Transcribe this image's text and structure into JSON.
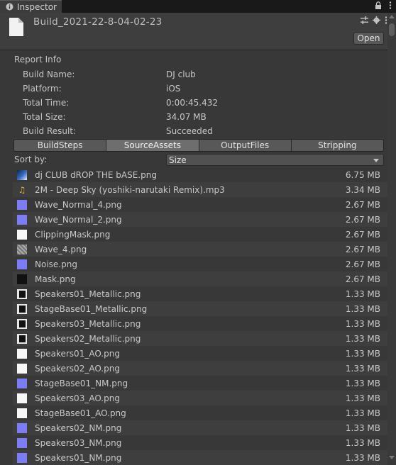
{
  "window": {
    "tab_label": "Inspector"
  },
  "header": {
    "title": "Build_2021-22-8-04-02-23",
    "open_button": "Open"
  },
  "report": {
    "section_title": "Report Info",
    "rows": [
      {
        "label": "Build Name:",
        "value": "DJ club"
      },
      {
        "label": "Platform:",
        "value": "iOS"
      },
      {
        "label": "Total Time:",
        "value": "0:00:45.432"
      },
      {
        "label": "Total Size:",
        "value": "34.07 MB"
      },
      {
        "label": "Build Result:",
        "value": "Succeeded"
      }
    ]
  },
  "tabs": [
    {
      "label": "BuildSteps",
      "active": false
    },
    {
      "label": "SourceAssets",
      "active": true
    },
    {
      "label": "OutputFiles",
      "active": false
    },
    {
      "label": "Stripping",
      "active": false
    }
  ],
  "sort": {
    "label": "Sort by:",
    "value": "Size"
  },
  "assets": [
    {
      "name": "dj CLUB dROP THE bASE.png",
      "size": "6.75 MB",
      "icon": "image-icon"
    },
    {
      "name": "2M - Deep Sky (yoshiki-narutaki Remix).mp3",
      "size": "3.34 MB",
      "icon": "audio-icon"
    },
    {
      "name": "Wave_Normal_4.png",
      "size": "2.67 MB",
      "icon": "normal-map-icon"
    },
    {
      "name": "Wave_Normal_2.png",
      "size": "2.67 MB",
      "icon": "normal-map-icon"
    },
    {
      "name": "ClippingMask.png",
      "size": "2.67 MB",
      "icon": "white-texture-icon"
    },
    {
      "name": "Wave_4.png",
      "size": "2.67 MB",
      "icon": "noise-texture-icon"
    },
    {
      "name": "Noise.png",
      "size": "2.67 MB",
      "icon": "normal-map-icon"
    },
    {
      "name": "Mask.png",
      "size": "2.67 MB",
      "icon": "mask-texture-icon"
    },
    {
      "name": "Speakers01_Metallic.png",
      "size": "1.33 MB",
      "icon": "metallic-texture-icon"
    },
    {
      "name": "StageBase01_Metallic.png",
      "size": "1.33 MB",
      "icon": "metallic-texture-icon"
    },
    {
      "name": "Speakers03_Metallic.png",
      "size": "1.33 MB",
      "icon": "metallic-texture-icon"
    },
    {
      "name": "Speakers02_Metallic.png",
      "size": "1.33 MB",
      "icon": "metallic-texture-icon"
    },
    {
      "name": "Speakers01_AO.png",
      "size": "1.33 MB",
      "icon": "white-texture-icon"
    },
    {
      "name": "Speakers02_AO.png",
      "size": "1.33 MB",
      "icon": "white-texture-icon"
    },
    {
      "name": "StageBase01_NM.png",
      "size": "1.33 MB",
      "icon": "normal-map-icon"
    },
    {
      "name": "Speakers03_AO.png",
      "size": "1.33 MB",
      "icon": "white-texture-icon"
    },
    {
      "name": "StageBase01_AO.png",
      "size": "1.33 MB",
      "icon": "white-texture-icon"
    },
    {
      "name": "Speakers02_NM.png",
      "size": "1.33 MB",
      "icon": "normal-map-icon"
    },
    {
      "name": "Speakers03_NM.png",
      "size": "1.33 MB",
      "icon": "normal-map-icon"
    },
    {
      "name": "Speakers01_NM.png",
      "size": "1.33 MB",
      "icon": "normal-map-icon"
    }
  ]
}
